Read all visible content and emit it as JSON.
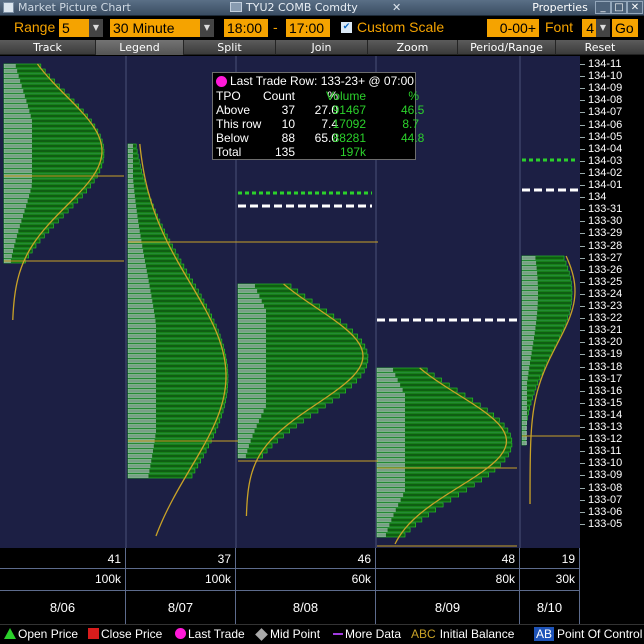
{
  "window": {
    "title": "Market Picture Chart",
    "ticker": "TYU2 COMB Comdty",
    "close_glyph": "✕",
    "properties_label": "Properties",
    "minimize": "_",
    "maximize": "□",
    "close": "✕"
  },
  "settings": {
    "range_label": "Range",
    "range_value": "5",
    "interval_value": "30 Minute",
    "start_time": "18:00",
    "dash": "-",
    "end_time": "17:00",
    "custom_scale_label": "Custom Scale",
    "custom_scale_checked": "✔",
    "scale_value": "0-00+",
    "font_label": "Font",
    "font_value": "4",
    "go_label": "Go"
  },
  "toolbar": {
    "buttons": [
      "Track",
      "Legend",
      "Split",
      "Join",
      "Zoom",
      "Period/Range",
      "Reset"
    ]
  },
  "popup": {
    "title": "Last Trade Row:  133-23+ @  07:00",
    "headers": [
      "TPO",
      "Count",
      "%",
      "Volume",
      "%"
    ],
    "rows": [
      {
        "label": "Above",
        "count": "37",
        "pct": "27.0",
        "volume": "91467",
        "vpct": "46.5"
      },
      {
        "label": "This row",
        "count": "10",
        "pct": "7.4",
        "volume": "17092",
        "vpct": "8.7"
      },
      {
        "label": "Below",
        "count": "88",
        "pct": "65.0",
        "volume": "88281",
        "vpct": "44.8"
      },
      {
        "label": "Total",
        "count": "135",
        "pct": "",
        "volume": "197k",
        "vpct": ""
      }
    ]
  },
  "price_axis": [
    "134-11",
    "134-10",
    "134-09",
    "134-08",
    "134-07",
    "134-06",
    "134-05",
    "134-04",
    "134-03",
    "134-02",
    "134-01",
    "134",
    "133-31",
    "133-30",
    "133-29",
    "133-28",
    "133-27",
    "133-26",
    "133-25",
    "133-24",
    "133-23",
    "133-22",
    "133-21",
    "133-20",
    "133-19",
    "133-18",
    "133-17",
    "133-16",
    "133-15",
    "133-14",
    "133-13",
    "133-12",
    "133-11",
    "133-10",
    "133-09",
    "133-08",
    "133-07",
    "133-06",
    "133-05"
  ],
  "sessions": [
    {
      "count": "41",
      "volume": "100k",
      "date": "8/06"
    },
    {
      "count": "37",
      "volume": "100k",
      "date": "8/07"
    },
    {
      "count": "46",
      "volume": "60k",
      "date": "8/08"
    },
    {
      "count": "48",
      "volume": "80k",
      "date": "8/09"
    },
    {
      "count": "19",
      "volume": "30k",
      "date": "8/10"
    }
  ],
  "legend": {
    "open_price": "Open Price",
    "close_price": "Close Price",
    "last_trade": "Last Trade",
    "mid_point": "Mid Point",
    "more_data": "More Data",
    "abc_glyph": "ABC",
    "initial_balance": "Initial Balance",
    "ab_glyph": "AB",
    "point_of_control": "Point Of Control"
  },
  "colors": {
    "background": "#1c1f44",
    "accent_orange": "#f5a300",
    "volume_green": "#2bd12b",
    "curve_yellow": "#c9a227",
    "last_trade_magenta": "#ff19d8"
  }
}
